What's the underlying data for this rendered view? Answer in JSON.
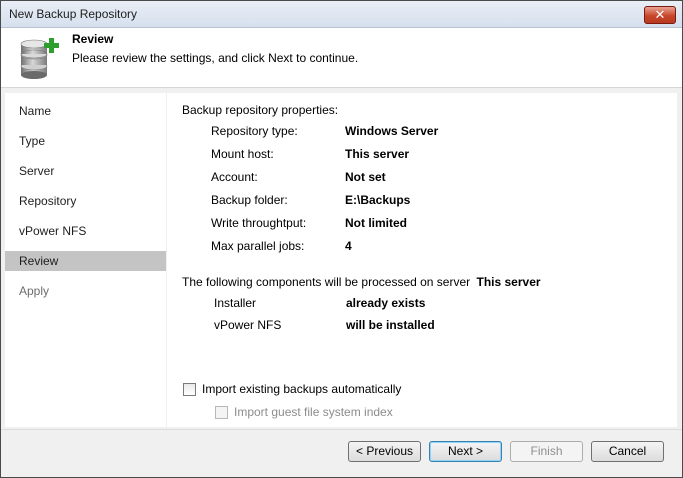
{
  "window": {
    "title": "New Backup Repository",
    "close_label": "✕"
  },
  "header": {
    "title": "Review",
    "subtitle": "Please review the settings, and click Next to continue."
  },
  "sidebar": {
    "items": [
      {
        "label": "Name"
      },
      {
        "label": "Type"
      },
      {
        "label": "Server"
      },
      {
        "label": "Repository"
      },
      {
        "label": "vPower NFS"
      },
      {
        "label": "Review"
      },
      {
        "label": "Apply"
      }
    ]
  },
  "properties": {
    "heading": "Backup repository properties:",
    "rows": [
      {
        "label": "Repository type:",
        "value": "Windows Server"
      },
      {
        "label": "Mount host:",
        "value": "This server"
      },
      {
        "label": "Account:",
        "value": "Not set"
      },
      {
        "label": "Backup folder:",
        "value": "E:\\Backups"
      },
      {
        "label": "Write throughtput:",
        "value": "Not limited"
      },
      {
        "label": "Max parallel jobs:",
        "value": "4"
      }
    ]
  },
  "components": {
    "heading": "The following components will be processed on server",
    "server": "This server",
    "rows": [
      {
        "label": "Installer",
        "value": "already exists"
      },
      {
        "label": "vPower NFS",
        "value": "will be installed"
      }
    ]
  },
  "options": {
    "import_backups_label": "Import existing backups automatically",
    "import_guest_index_label": "Import guest file system index"
  },
  "buttons": {
    "previous": "< Previous",
    "next": "Next >",
    "finish": "Finish",
    "cancel": "Cancel"
  },
  "colors": {
    "selected_nav": "#c4c4c4",
    "db_icon": "#7a7a7a",
    "plus_icon": "#2e9e2e",
    "close_button": "#c8462b"
  }
}
